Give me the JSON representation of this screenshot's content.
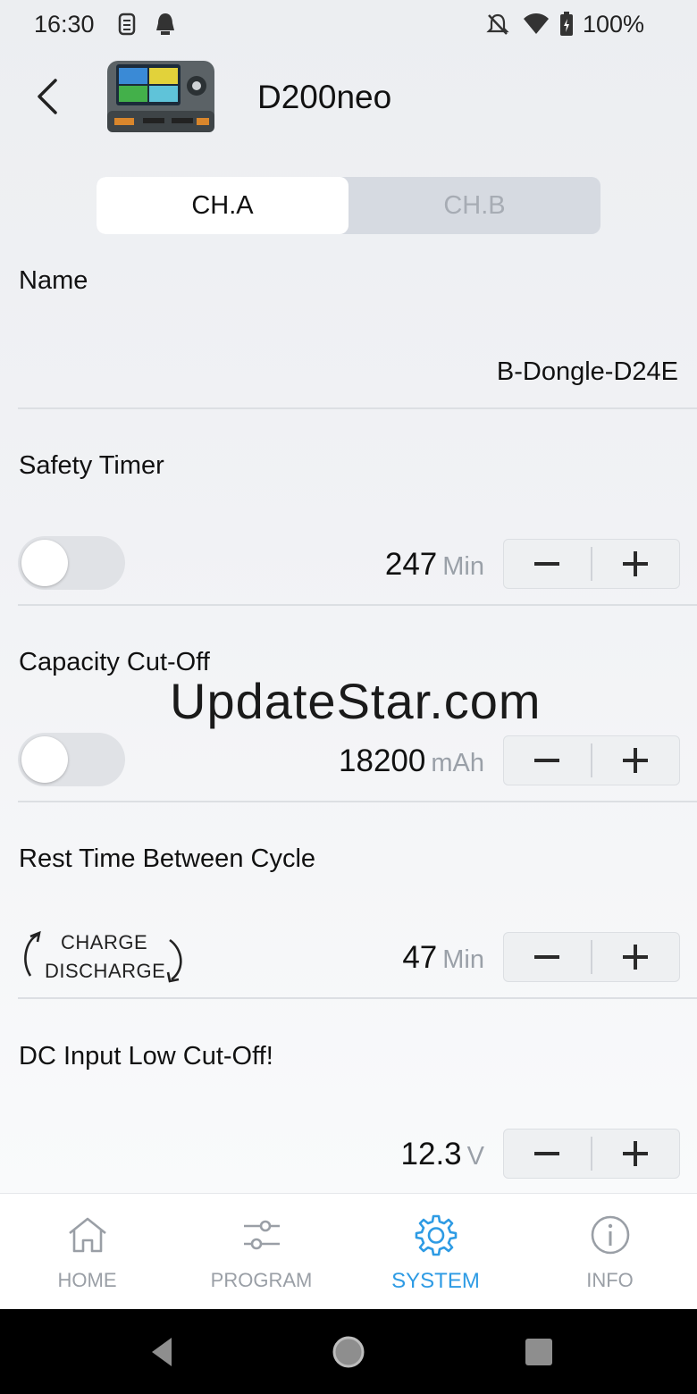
{
  "status_bar": {
    "time": "16:30",
    "battery": "100%"
  },
  "header": {
    "title": "D200neo"
  },
  "tabs": [
    {
      "label": "CH.A",
      "active": true
    },
    {
      "label": "CH.B",
      "active": false
    }
  ],
  "settings": {
    "name": {
      "label": "Name",
      "value": "B-Dongle-D24E"
    },
    "safety_timer": {
      "label": "Safety Timer",
      "enabled": false,
      "value": "247",
      "unit": "Min"
    },
    "capacity_cutoff": {
      "label": "Capacity Cut-Off",
      "enabled": false,
      "value": "18200",
      "unit": "mAh"
    },
    "rest_time": {
      "label": "Rest Time Between Cycle",
      "cycle_line1": "CHARGE",
      "cycle_line2": "DISCHARGE",
      "value": "47",
      "unit": "Min"
    },
    "dc_input": {
      "label": "DC Input Low Cut-Off!",
      "value": "12.3",
      "unit": "V"
    }
  },
  "watermark": "UpdateStar.com",
  "bottom_nav": [
    {
      "label": "HOME",
      "icon": "home-icon",
      "active": false
    },
    {
      "label": "PROGRAM",
      "icon": "sliders-icon",
      "active": false
    },
    {
      "label": "SYSTEM",
      "icon": "gear-icon",
      "active": true
    },
    {
      "label": "INFO",
      "icon": "info-icon",
      "active": false
    }
  ],
  "colors": {
    "accent": "#2e9be4",
    "inactive_nav": "#9a9fa6",
    "toggle_off": "#e0e2e6",
    "tab_inactive_bg": "#d6dae1"
  }
}
